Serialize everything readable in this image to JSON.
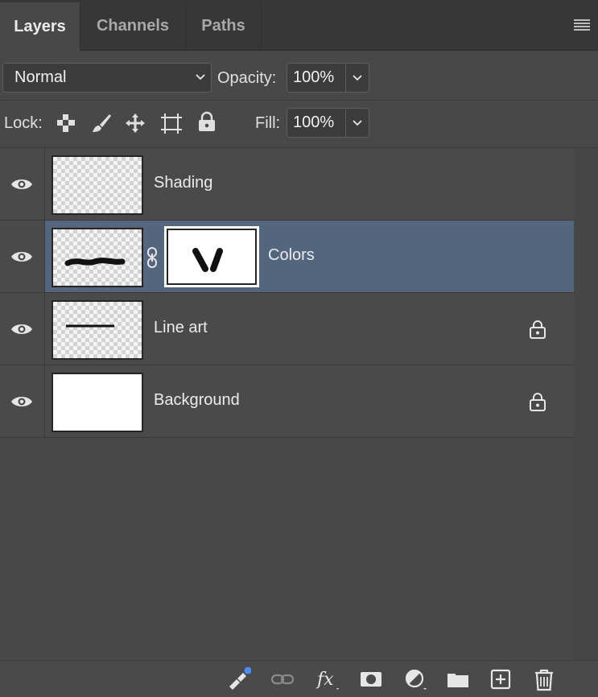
{
  "tabs": [
    {
      "label": "Layers",
      "active": true
    },
    {
      "label": "Channels",
      "active": false
    },
    {
      "label": "Paths",
      "active": false
    }
  ],
  "blend_mode": {
    "value": "Normal"
  },
  "opacity": {
    "label": "Opacity:",
    "value": "100%"
  },
  "lock": {
    "label": "Lock:",
    "icons": [
      "lock-transparent-pixels-icon",
      "lock-image-pixels-icon",
      "lock-position-icon",
      "lock-artboard-icon",
      "lock-all-icon"
    ]
  },
  "fill": {
    "label": "Fill:",
    "value": "100%"
  },
  "layers": [
    {
      "name": "Shading",
      "visible": true,
      "selected": false,
      "locked": false,
      "thumbnail": "transparent"
    },
    {
      "name": "Colors",
      "visible": true,
      "selected": true,
      "locked": false,
      "thumbnail": "brush-stroke",
      "mask": true
    },
    {
      "name": "Line art",
      "visible": true,
      "selected": false,
      "locked": true,
      "thumbnail": "line"
    },
    {
      "name": "Background",
      "visible": true,
      "selected": false,
      "locked": true,
      "thumbnail": "white"
    }
  ],
  "footer_icons": [
    "search-filter-icon",
    "link-layers-icon",
    "fx-icon",
    "add-mask-icon",
    "adjustment-layer-icon",
    "new-group-icon",
    "new-layer-icon",
    "delete-layer-icon"
  ],
  "colors": {
    "selected_row": "#54657e",
    "panel_bg": "#4a4a4a",
    "notification_dot": "#4b8df8"
  }
}
